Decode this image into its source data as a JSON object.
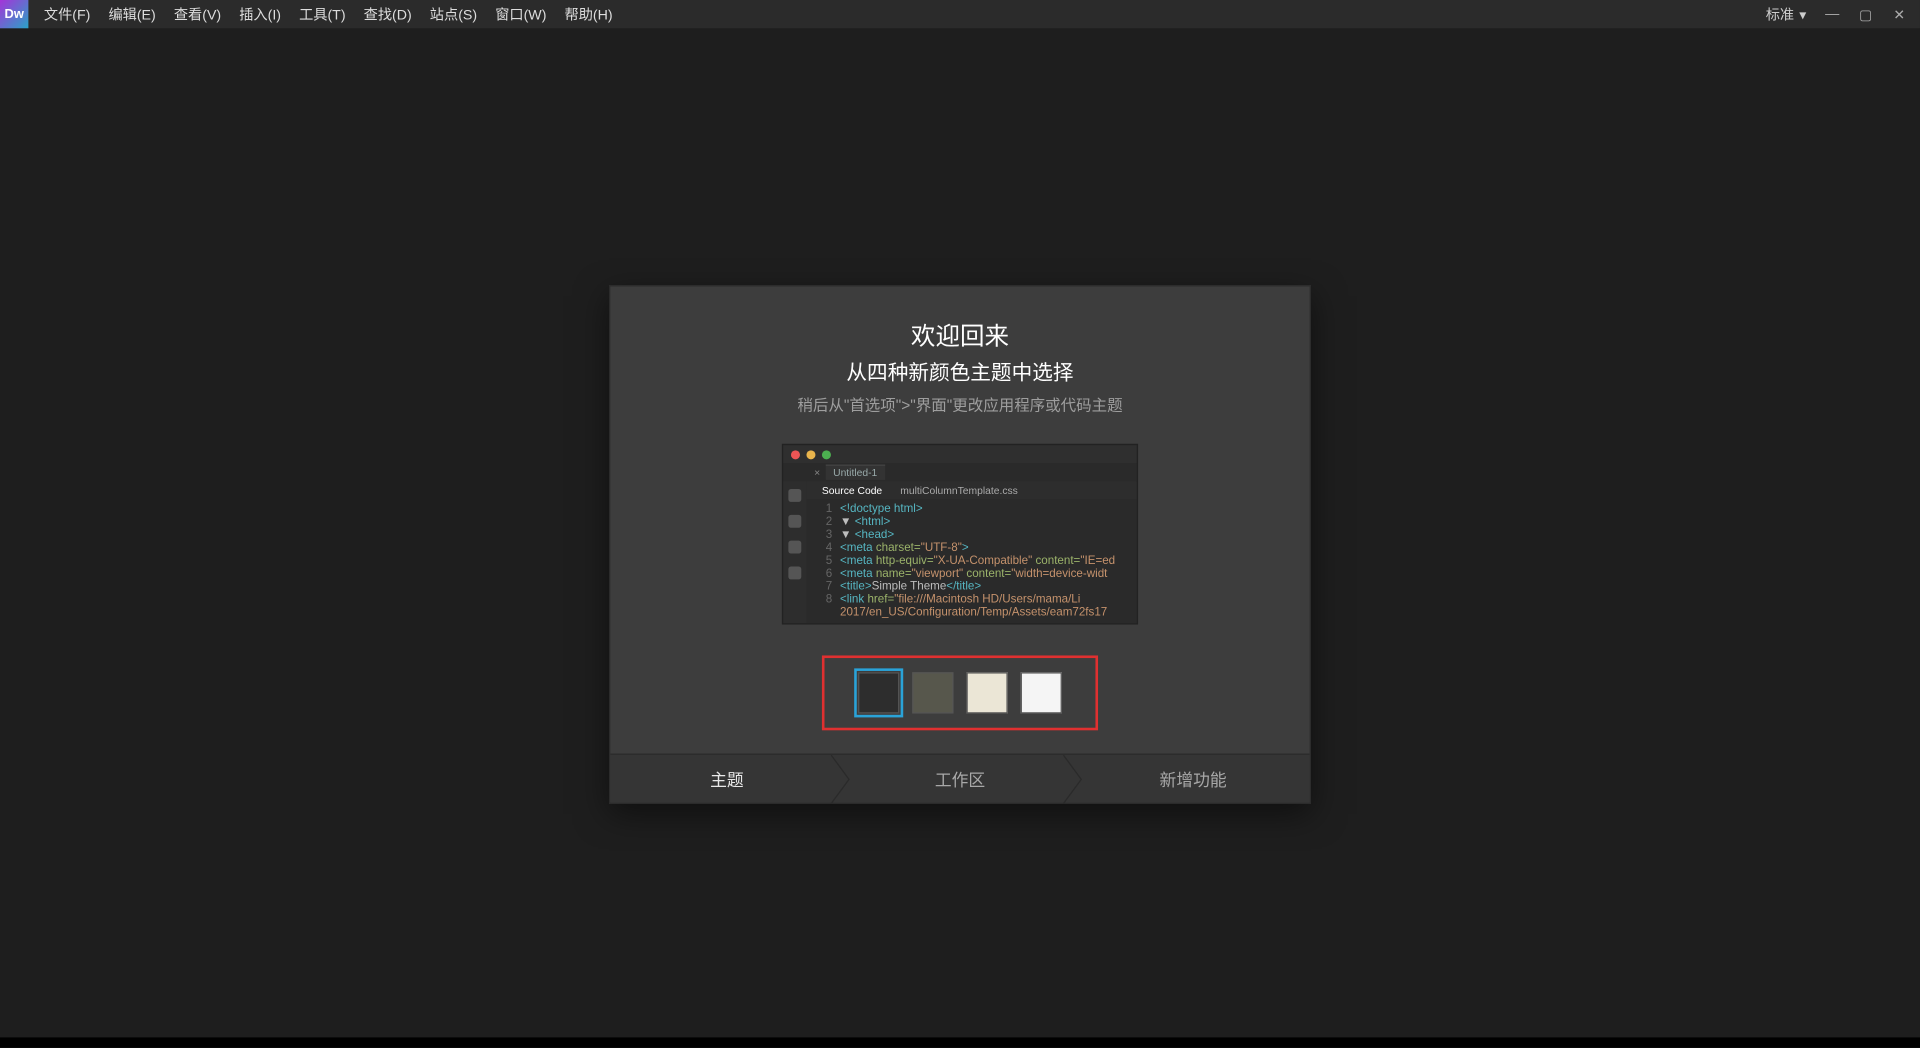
{
  "app": {
    "logo_text": "Dw"
  },
  "menubar": {
    "items": [
      "文件(F)",
      "编辑(E)",
      "查看(V)",
      "插入(I)",
      "工具(T)",
      "查找(D)",
      "站点(S)",
      "窗口(W)",
      "帮助(H)"
    ],
    "workspace_label": "标准"
  },
  "dialog": {
    "title": "欢迎回来",
    "subtitle": "从四种新颜色主题中选择",
    "hint": "稍后从\"首选项\">\"界面\"更改应用程序或代码主题",
    "nav": {
      "theme": "主题",
      "workspace": "工作区",
      "whatsnew": "新增功能"
    }
  },
  "preview": {
    "tab_name": "Untitled-1",
    "source_tab": "Source Code",
    "css_tab": "multiColumnTemplate.css",
    "lines": [
      {
        "n": "1",
        "html": "<span class='kw'>&lt;!doctype html&gt;</span>"
      },
      {
        "n": "2",
        "html": "<span class='txt'>▼</span> <span class='tag'>&lt;html&gt;</span>"
      },
      {
        "n": "3",
        "html": "<span class='txt'>▼</span> <span class='tag'>&lt;head&gt;</span>"
      },
      {
        "n": "4",
        "html": "<span class='tag'>&lt;meta</span> <span class='at'>charset=</span><span class='str'>\"UTF-8\"</span><span class='tag'>&gt;</span>"
      },
      {
        "n": "5",
        "html": "<span class='tag'>&lt;meta</span> <span class='at'>http-equiv=</span><span class='str'>\"X-UA-Compatible\"</span> <span class='at'>content=</span><span class='str'>\"IE=ed</span>"
      },
      {
        "n": "6",
        "html": "<span class='tag'>&lt;meta</span> <span class='at'>name=</span><span class='str'>\"viewport\"</span> <span class='at'>content=</span><span class='str'>\"width=device-widt</span>"
      },
      {
        "n": "7",
        "html": "<span class='tag'>&lt;title&gt;</span><span class='txt'>Simple Theme</span><span class='tag'>&lt;/title&gt;</span>"
      },
      {
        "n": "8",
        "html": "<span class='tag'>&lt;link</span> <span class='at'>href=</span><span class='str'>\"file:///Macintosh HD/Users/mama/Li</span>"
      },
      {
        "n": "",
        "html": "<span class='str'>2017/en_US/Configuration/Temp/Assets/eam72fs17</span>"
      }
    ]
  },
  "swatches": [
    {
      "color": "#2d2d2d",
      "selected": true
    },
    {
      "color": "#57574c",
      "selected": false
    },
    {
      "color": "#ebe6d6",
      "selected": false
    },
    {
      "color": "#f5f5f5",
      "selected": false
    }
  ]
}
